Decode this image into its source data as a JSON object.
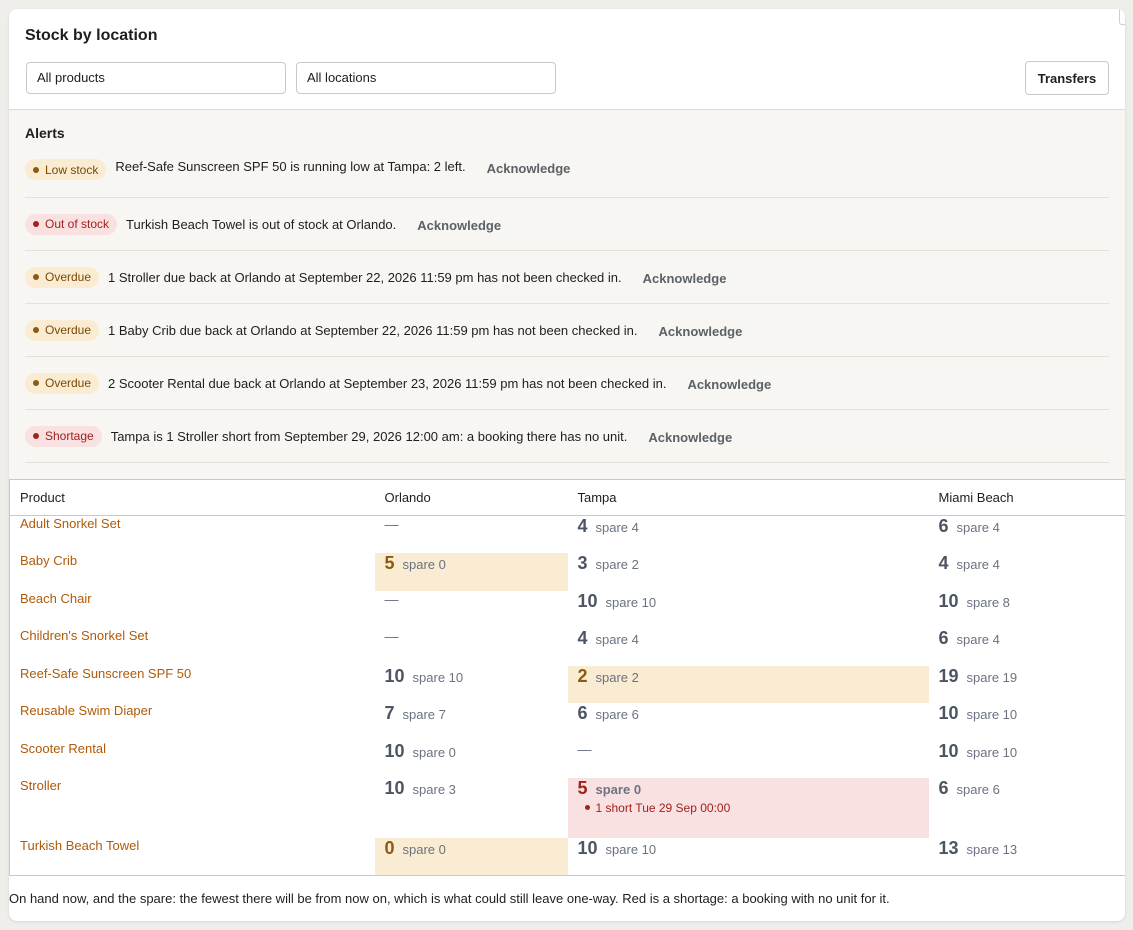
{
  "title": "Stock by location",
  "filters": {
    "products": "All products",
    "locations": "All locations",
    "transfers_label": "Transfers"
  },
  "alerts": {
    "title": "Alerts",
    "ack_label": "Acknowledge",
    "items": [
      {
        "badge": "Low stock",
        "tone": "amber",
        "text": "Reef-Safe Sunscreen SPF 50 is running low at Tampa: 2 left."
      },
      {
        "badge": "Out of stock",
        "tone": "red",
        "text": "Turkish Beach Towel is out of stock at Orlando."
      },
      {
        "badge": "Overdue",
        "tone": "amber",
        "text": "1 Stroller due back at Orlando at September 22, 2026 11:59 pm has not been checked in."
      },
      {
        "badge": "Overdue",
        "tone": "amber",
        "text": "1 Baby Crib due back at Orlando at September 22, 2026 11:59 pm has not been checked in."
      },
      {
        "badge": "Overdue",
        "tone": "amber",
        "text": "2 Scooter Rental due back at Orlando at September 23, 2026 11:59 pm has not been checked in."
      },
      {
        "badge": "Shortage",
        "tone": "red",
        "text": "Tampa is 1 Stroller short from September 29, 2026 12:00 am: a booking there has no unit."
      }
    ]
  },
  "table": {
    "columns": [
      "Product",
      "Orlando",
      "Tampa",
      "Miami Beach"
    ],
    "spare_prefix": "spare",
    "rows": [
      {
        "product": "Adult Snorkel Set",
        "cells": [
          {
            "dash": "—"
          },
          {
            "qty": "4",
            "spare": "spare 4"
          },
          {
            "qty": "6",
            "spare": "spare 4"
          }
        ]
      },
      {
        "product": "Baby Crib",
        "cells": [
          {
            "qty": "5",
            "spare": "spare 0",
            "state": "warn"
          },
          {
            "qty": "3",
            "spare": "spare 2"
          },
          {
            "qty": "4",
            "spare": "spare 4"
          }
        ]
      },
      {
        "product": "Beach Chair",
        "cells": [
          {
            "dash": "—"
          },
          {
            "qty": "10",
            "spare": "spare 10"
          },
          {
            "qty": "10",
            "spare": "spare 8"
          }
        ]
      },
      {
        "product": "Children's Snorkel Set",
        "cells": [
          {
            "dash": "—"
          },
          {
            "qty": "4",
            "spare": "spare 4"
          },
          {
            "qty": "6",
            "spare": "spare 4"
          }
        ]
      },
      {
        "product": "Reef-Safe Sunscreen SPF 50",
        "cells": [
          {
            "qty": "10",
            "spare": "spare 10"
          },
          {
            "qty": "2",
            "spare": "spare 2",
            "state": "warn"
          },
          {
            "qty": "19",
            "spare": "spare 19"
          }
        ]
      },
      {
        "product": "Reusable Swim Diaper",
        "cells": [
          {
            "qty": "7",
            "spare": "spare 7"
          },
          {
            "qty": "6",
            "spare": "spare 6"
          },
          {
            "qty": "10",
            "spare": "spare 10"
          }
        ]
      },
      {
        "product": "Scooter Rental",
        "cells": [
          {
            "qty": "10",
            "spare": "spare 0"
          },
          {
            "dash": "—"
          },
          {
            "qty": "10",
            "spare": "spare 10"
          }
        ]
      },
      {
        "product": "Stroller",
        "cells": [
          {
            "qty": "10",
            "spare": "spare 3"
          },
          {
            "qty": "5",
            "spare": "spare 0",
            "state": "short",
            "note": "1 short Tue 29 Sep 00:00"
          },
          {
            "qty": "6",
            "spare": "spare 6"
          }
        ]
      },
      {
        "product": "Turkish Beach Towel",
        "cells": [
          {
            "qty": "0",
            "spare": "spare 0",
            "state": "warn"
          },
          {
            "qty": "10",
            "spare": "spare 10"
          },
          {
            "qty": "13",
            "spare": "spare 13"
          }
        ]
      }
    ]
  },
  "footnote": "On hand now, and the spare: the fewest there will be from now on, which is what could still leave one-way. Red is a shortage: a booking with no unit for it.",
  "colors": {
    "accent_link": "#b05a08",
    "warn_bg": "#f9ecd2",
    "short_bg": "#f9e1e1",
    "short_text": "#a3201d"
  }
}
